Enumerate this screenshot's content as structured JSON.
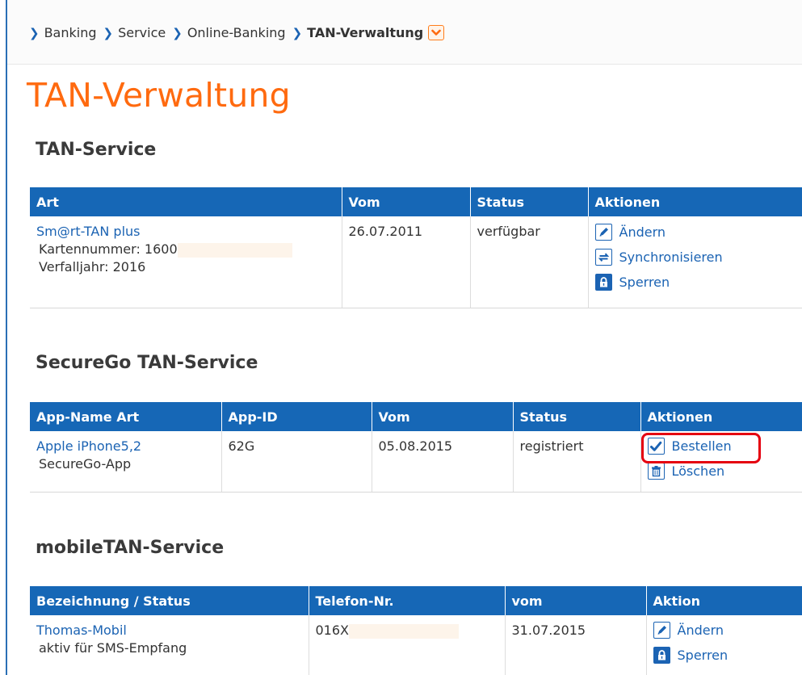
{
  "breadcrumb": {
    "items": [
      "Banking",
      "Service",
      "Online-Banking",
      "TAN-Verwaltung"
    ]
  },
  "page_title": "TAN-Verwaltung",
  "tan_service": {
    "title": "TAN-Service",
    "columns": [
      "Art",
      "Vom",
      "Status",
      "Aktionen"
    ],
    "row": {
      "name": "Sm@rt-TAN plus",
      "card_number": "Kartennummer: 1600",
      "expiry": "Verfalljahr: 2016",
      "date": "26.07.2011",
      "status": "verfügbar",
      "actions": [
        "Ändern",
        "Synchronisieren",
        "Sperren"
      ]
    }
  },
  "securego_service": {
    "title": "SecureGo TAN-Service",
    "columns": [
      "App-Name Art",
      "App-ID",
      "Vom",
      "Status",
      "Aktionen"
    ],
    "row": {
      "name": "Apple iPhone5,2",
      "type": "SecureGo-App",
      "app_id": "62G",
      "date": "05.08.2015",
      "status": "registriert",
      "actions": [
        "Bestellen",
        "Löschen"
      ]
    }
  },
  "mobiletan_service": {
    "title": "mobileTAN-Service",
    "columns": [
      "Bezeichnung / Status",
      "Telefon-Nr.",
      "vom",
      "Aktion"
    ],
    "row": {
      "name": "Thomas-Mobil",
      "status": "aktiv für SMS-Empfang",
      "phone": "016X",
      "date": "31.07.2015",
      "actions": [
        "Ändern",
        "Sperren"
      ]
    }
  },
  "icons": {
    "breadcrumb_separator": "chevron-right-icon",
    "breadcrumb_menu": "chevron-down-icon",
    "edit": "pencil-icon",
    "sync": "sync-arrows-icon",
    "lock": "lock-icon",
    "order": "checkmark-icon",
    "delete": "trash-icon"
  },
  "colors": {
    "title_orange": "#ff6a0f",
    "header_blue": "#1667b6",
    "link_blue": "#1b63b3",
    "highlight_red": "#e50010"
  }
}
